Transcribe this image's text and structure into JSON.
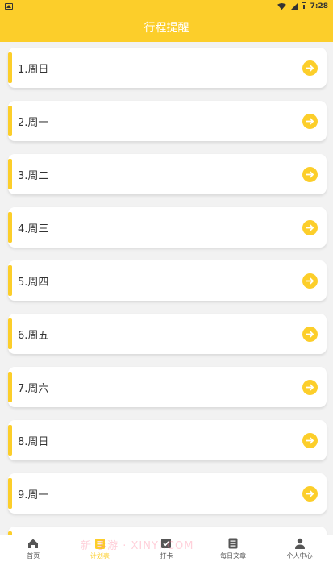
{
  "status_bar": {
    "time": "7:28"
  },
  "header": {
    "title": "行程提醒"
  },
  "list": {
    "items": [
      {
        "label": "1.周日"
      },
      {
        "label": "2.周一"
      },
      {
        "label": "3.周二"
      },
      {
        "label": "4.周三"
      },
      {
        "label": "5.周四"
      },
      {
        "label": "6.周五"
      },
      {
        "label": "7.周六"
      },
      {
        "label": "8.周日"
      },
      {
        "label": "9.周一"
      },
      {
        "label": ""
      }
    ]
  },
  "tabs": [
    {
      "label": "首页",
      "icon": "home-icon"
    },
    {
      "label": "计划表",
      "icon": "plan-icon",
      "active": true
    },
    {
      "label": "打卡",
      "icon": "checkin-icon"
    },
    {
      "label": "每日文章",
      "icon": "article-icon"
    },
    {
      "label": "个人中心",
      "icon": "user-icon"
    }
  ],
  "watermark": "新 手游 · XINYI.COM",
  "colors": {
    "accent": "#fcce2a",
    "background": "#f2f2f2"
  }
}
